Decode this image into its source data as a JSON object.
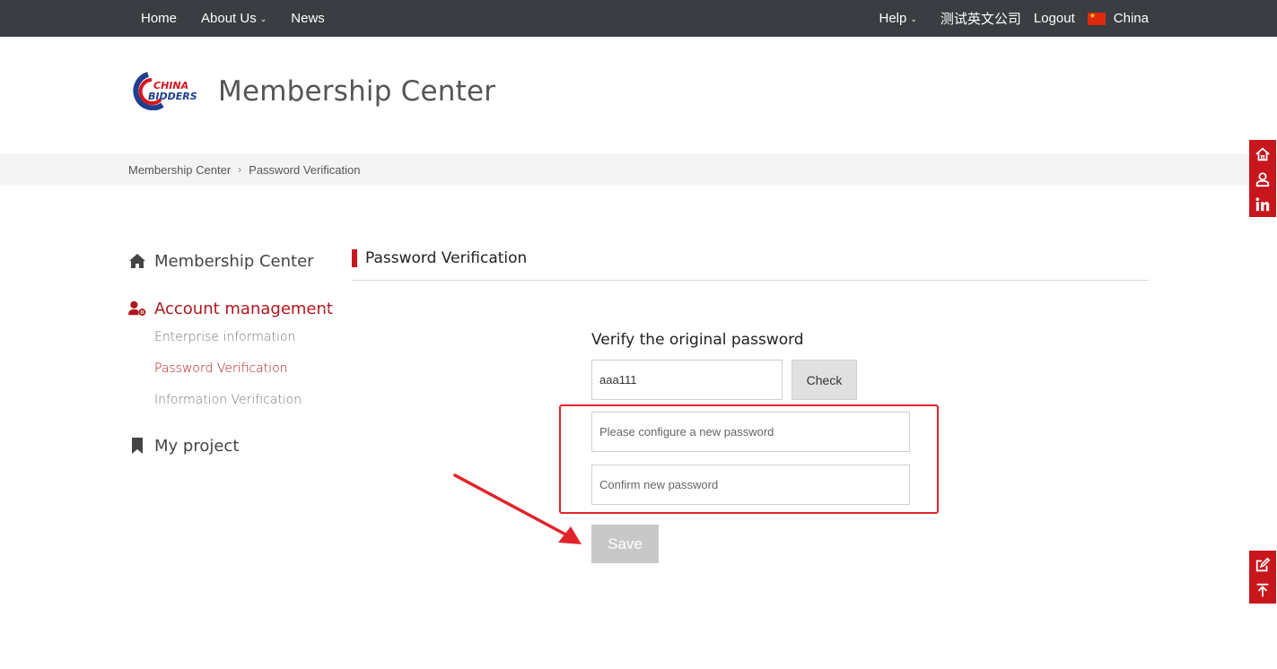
{
  "topnav": {
    "left": [
      {
        "label": "Home",
        "has_caret": false
      },
      {
        "label": "About Us",
        "has_caret": true
      },
      {
        "label": "News",
        "has_caret": false
      }
    ],
    "help_label": "Help",
    "company_label": "测试英文公司",
    "logout_label": "Logout",
    "region_label": "China"
  },
  "header": {
    "title": "Membership Center"
  },
  "breadcrumb": {
    "items": [
      "Membership Center",
      "Password Verification"
    ],
    "separator": "›"
  },
  "sidebar": {
    "membership_label": "Membership Center",
    "account_label": "Account management",
    "sub_items": [
      {
        "label": "Enterprise information",
        "active": false
      },
      {
        "label": "Password Verification",
        "active": true
      },
      {
        "label": "Information Verification",
        "active": false
      }
    ],
    "project_label": "My project"
  },
  "main": {
    "section_title": "Password Verification",
    "verify_label": "Verify the original password",
    "original_password_value": "aaa111",
    "check_label": "Check",
    "new_password_placeholder": "Please configure a new password",
    "confirm_password_placeholder": "Confirm new password",
    "save_label": "Save"
  },
  "colors": {
    "brand_red": "#c8161d",
    "topbar": "#3a3d42",
    "annotation_red": "#e0242b"
  },
  "side_tools": {
    "top": [
      "home-icon",
      "user-icon",
      "linkedin-icon"
    ],
    "bottom": [
      "edit-icon",
      "back-to-top-icon"
    ]
  }
}
